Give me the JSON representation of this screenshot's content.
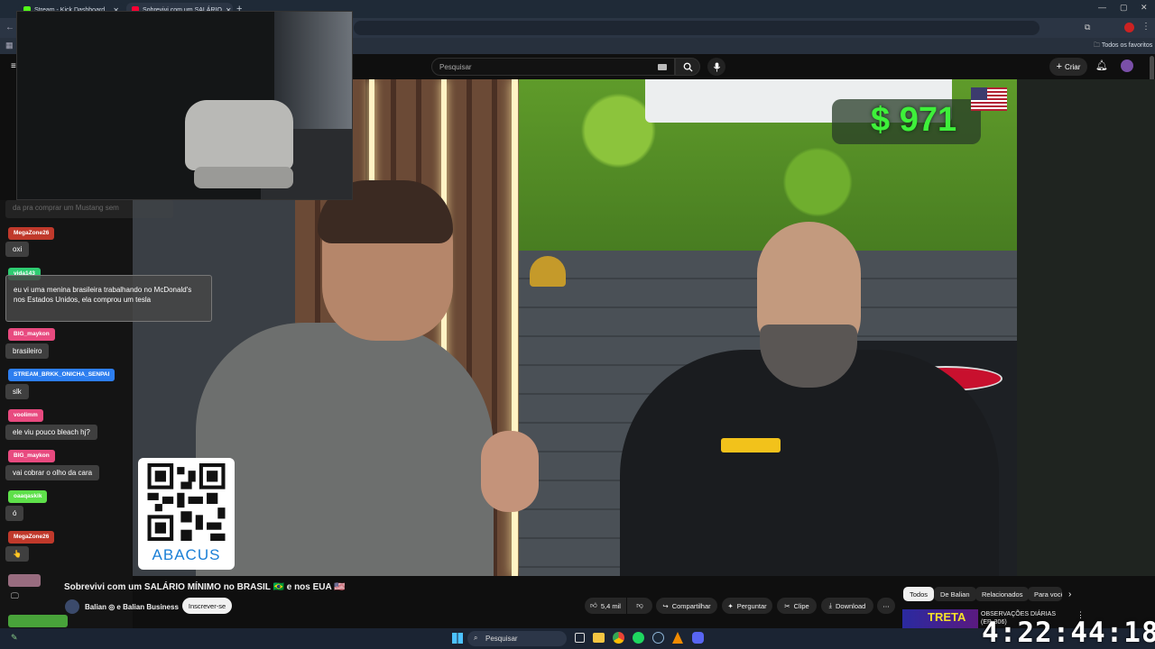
{
  "browser": {
    "tabs": [
      {
        "label": "Stream - Kick Dashboard",
        "fav_color": "#53fc18"
      },
      {
        "label": "Sobrevivi com um SALÁRIO",
        "fav_color": "#ff0033"
      }
    ],
    "bookmarks_label": "Todos os favoritos"
  },
  "youtube": {
    "search_placeholder": "Pesquisar",
    "create_label": "Criar"
  },
  "video": {
    "price_overlay": "$ 971",
    "qr_brand": "ABACUS",
    "title": "Sobrevivi com um SALÁRIO MÍNIMO no BRASIL 🇧🇷 e nos EUA 🇺🇸",
    "channel": "Balian ◎ e Balian Business",
    "subscribe_label": "Inscrever-se",
    "likes": "5,4 mil",
    "actions": [
      "Compartilhar",
      "Perguntar",
      "Clipe",
      "Download"
    ],
    "chips": [
      "Todos",
      "De Balian",
      "Relacionados",
      "Para você"
    ],
    "suggested_title": "OBSERVAÇÕES DIÁRIAS (EP. 306)",
    "suggested_thumb_text": "TRETA"
  },
  "chat": {
    "faded_msg": "da pra comprar um Mustang sem",
    "messages": [
      {
        "user": "MegaZone26",
        "color": "#c0392b",
        "text": "oxi"
      },
      {
        "user": "vida143",
        "color": "#2ecc71",
        "text": "eu vi uma menina brasileira trabalhando no McDonald's nos Estados Unidos, ela comprou um tesla"
      },
      {
        "user": "BIG_maykon",
        "color": "#e84a7f",
        "text": "brasileiro"
      },
      {
        "user": "STREAM_BRKK_ONICHA_SENPAI",
        "color": "#2d7ef0",
        "text": "slk"
      },
      {
        "user": "voolimm",
        "color": "#e84a7f",
        "text": "ele viu pouco bleach hj?"
      },
      {
        "user": "BIG_maykon",
        "color": "#e84a7f",
        "text": "vai cobrar o olho da cara"
      },
      {
        "user": "oaaqaskik",
        "color": "#5ee04a",
        "text": "ó"
      },
      {
        "user": "MegaZone26",
        "color": "#c0392b",
        "text": "👆"
      }
    ]
  },
  "taskbar": {
    "search_placeholder": "Pesquisar"
  },
  "clock": "4:22:44:18"
}
